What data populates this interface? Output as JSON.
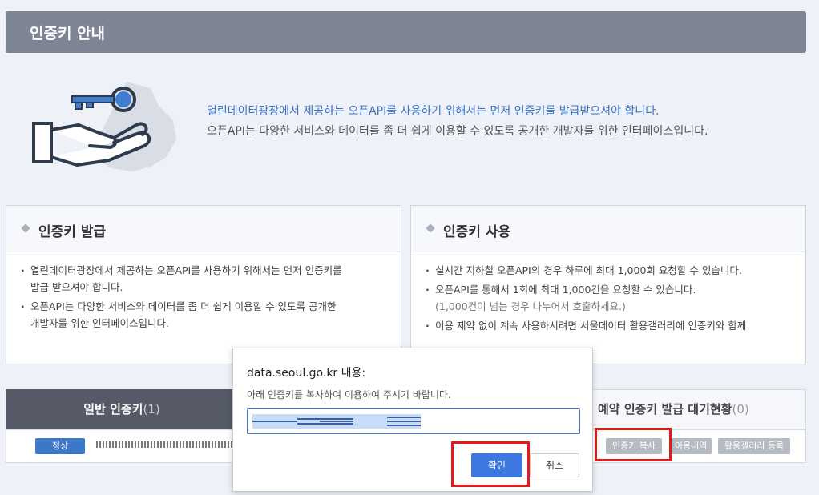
{
  "header": {
    "title": "인증키 안내"
  },
  "intro": {
    "icon": "key-in-hand-icon",
    "line1": "열린데이터광장에서 제공하는 오픈API를 사용하기 위해서는 먼저 인증키를 발급받으셔야 합니다.",
    "line2": "오픈API는 다양한 서비스와 데이터를 좀 더 쉽게 이용할 수 있도록 공개한 개발자를 위한 인터페이스입니다."
  },
  "cards": {
    "issue": {
      "title": "인증키 발급",
      "items": [
        [
          "열린데이터광장에서 제공하는 오픈API를 사용하기 위해서는 먼저 인증키를",
          "발급 받으셔야 합니다."
        ],
        [
          "오픈API는 다양한 서비스와 데이터를 좀 더 쉽게 이용할 수 있도록 공개한",
          "개발자를 위한 인터페이스입니다."
        ]
      ]
    },
    "usage": {
      "title": "인증키 사용",
      "item1": "실시간 지하철 오픈API의 경우 하루에 최대 1,000회 요청할 수 있습니다.",
      "item2": "오픈API를 통해서 1회에 최대 1,000건을 요청할 수 있습니다.",
      "item2_sub": "(1,000건이 넘는 경우 나누어서 호출하세요.)",
      "item3": "이용 제약 없이 계속 사용하시려면 서울데이터 활용갤러리에 인증키와 함께"
    }
  },
  "keys": {
    "general_tab": {
      "label": "일반 인증키",
      "count": "(1)"
    },
    "reserve_tab": {
      "label": "예약 인증키 발급 대기현황",
      "count": "(0)"
    },
    "row": {
      "status": "정상",
      "copy_button": "인증키 복사",
      "usage_button": "이용내역",
      "gallery_button": "활용갤러리 등록"
    }
  },
  "dialog": {
    "title": "data.seoul.go.kr 내용:",
    "message": "아래 인증키를 복사하여 이용하여 주시기 바랍니다.",
    "ok": "확인",
    "cancel": "취소"
  },
  "colors": {
    "header_bg": "#7d8494",
    "accent": "#3c78c8",
    "highlight": "#e01b1b"
  }
}
